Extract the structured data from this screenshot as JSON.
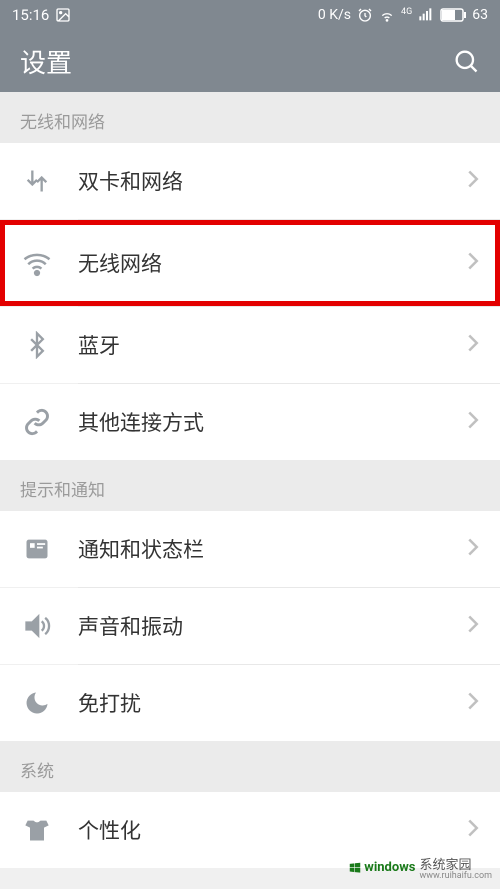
{
  "status": {
    "time": "15:16",
    "net_speed": "0 K/s",
    "battery": "63",
    "mobile_gen": "4G"
  },
  "header": {
    "title": "设置"
  },
  "sections": {
    "wireless": {
      "title": "无线和网络",
      "items": [
        {
          "label": "双卡和网络"
        },
        {
          "label": "无线网络"
        },
        {
          "label": "蓝牙"
        },
        {
          "label": "其他连接方式"
        }
      ]
    },
    "notify": {
      "title": "提示和通知",
      "items": [
        {
          "label": "通知和状态栏"
        },
        {
          "label": "声音和振动"
        },
        {
          "label": "免打扰"
        }
      ]
    },
    "system": {
      "title": "系统",
      "items": [
        {
          "label": "个性化"
        }
      ]
    }
  },
  "watermark": {
    "brand": "windows",
    "text": "系统家园",
    "url": "www.ruihaifu.com"
  }
}
